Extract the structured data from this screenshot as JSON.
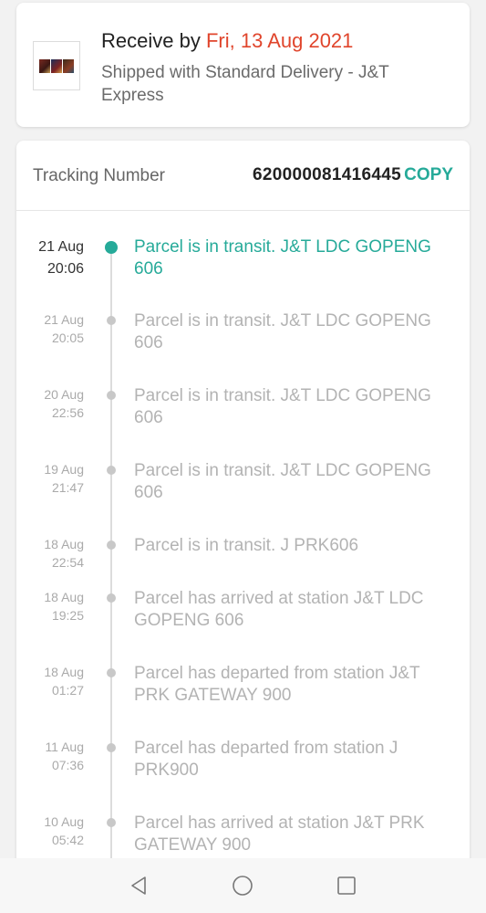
{
  "summary": {
    "receive_prefix": "Receive by ",
    "receive_date": "Fri, 13 Aug 2021",
    "shipped_text": "Shipped with Standard Delivery  - J&T Express"
  },
  "tracking": {
    "label": "Tracking Number",
    "number": "620000081416445",
    "copy_label": "COPY"
  },
  "events": [
    {
      "date": "21 Aug",
      "time": "20:06",
      "desc": "Parcel is in transit. J&T LDC GOPENG 606",
      "active": true
    },
    {
      "date": "21 Aug",
      "time": "20:05",
      "desc": "Parcel is in transit. J&T LDC GOPENG 606"
    },
    {
      "date": "20 Aug",
      "time": "22:56",
      "desc": "Parcel is in transit. J&T LDC GOPENG 606"
    },
    {
      "date": "19 Aug",
      "time": "21:47",
      "desc": "Parcel is in transit. J&T LDC GOPENG 606"
    },
    {
      "date": "18 Aug",
      "time": "22:54",
      "desc": "Parcel is in transit. J PRK606"
    },
    {
      "date": "18 Aug",
      "time": "19:25",
      "desc": "Parcel has arrived at station J&T LDC GOPENG 606"
    },
    {
      "date": "18 Aug",
      "time": "01:27",
      "desc": "Parcel has departed from station J&T PRK GATEWAY 900"
    },
    {
      "date": "11 Aug",
      "time": "07:36",
      "desc": "Parcel has departed from station J PRK900"
    },
    {
      "date": "10 Aug",
      "time": "05:42",
      "desc": "Parcel has arrived at station J&T PRK GATEWAY 900"
    }
  ],
  "colors": {
    "accent": "#26aa99",
    "date_highlight": "#e0452c"
  },
  "nav_icons": [
    "back-icon",
    "home-icon",
    "recent-apps-icon"
  ]
}
